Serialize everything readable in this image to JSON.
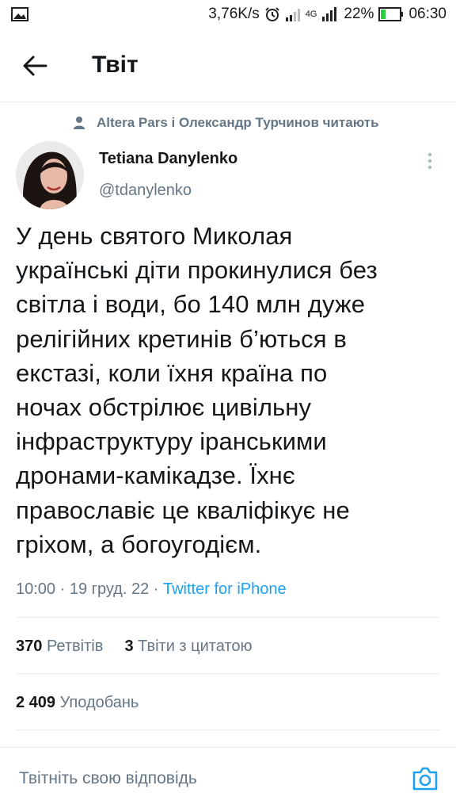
{
  "status_bar": {
    "speed": "3,76K/s",
    "network": "4G",
    "battery": "22%",
    "time": "06:30"
  },
  "header": {
    "title": "Твіт"
  },
  "social_context": "Altera Pars і Олександр Турчинов читають",
  "author": {
    "name": "Tetiana Danylenko",
    "handle": "@tdanylenko"
  },
  "tweet": {
    "lines": [
      "У день святого Миколая",
      "українські діти прокинулися без",
      "світла і води, бо 140 млн дуже",
      "релігійних кретинів б’ються в",
      "екстазі, коли їхня країна по",
      "ночах обстрілює цивільну",
      "інфраструктуру іранськими",
      "дронами-камікадзе. Їхнє",
      "православіє це кваліфікує не",
      "гріхом, а богоугодієм."
    ],
    "time": "10:00",
    "date": "19 груд. 22",
    "source": "Twitter for iPhone"
  },
  "stats": {
    "retweets_count": "370",
    "retweets_label": "Ретвітів",
    "quotes_count": "3",
    "quotes_label": "Твіти з цитатою",
    "likes_count": "2 409",
    "likes_label": "Уподобань"
  },
  "reply": {
    "placeholder": "Твітніть свою відповідь"
  },
  "colors": {
    "accent": "#1da1f2",
    "secondary_text": "#657786",
    "divider": "#e6ecf0"
  }
}
